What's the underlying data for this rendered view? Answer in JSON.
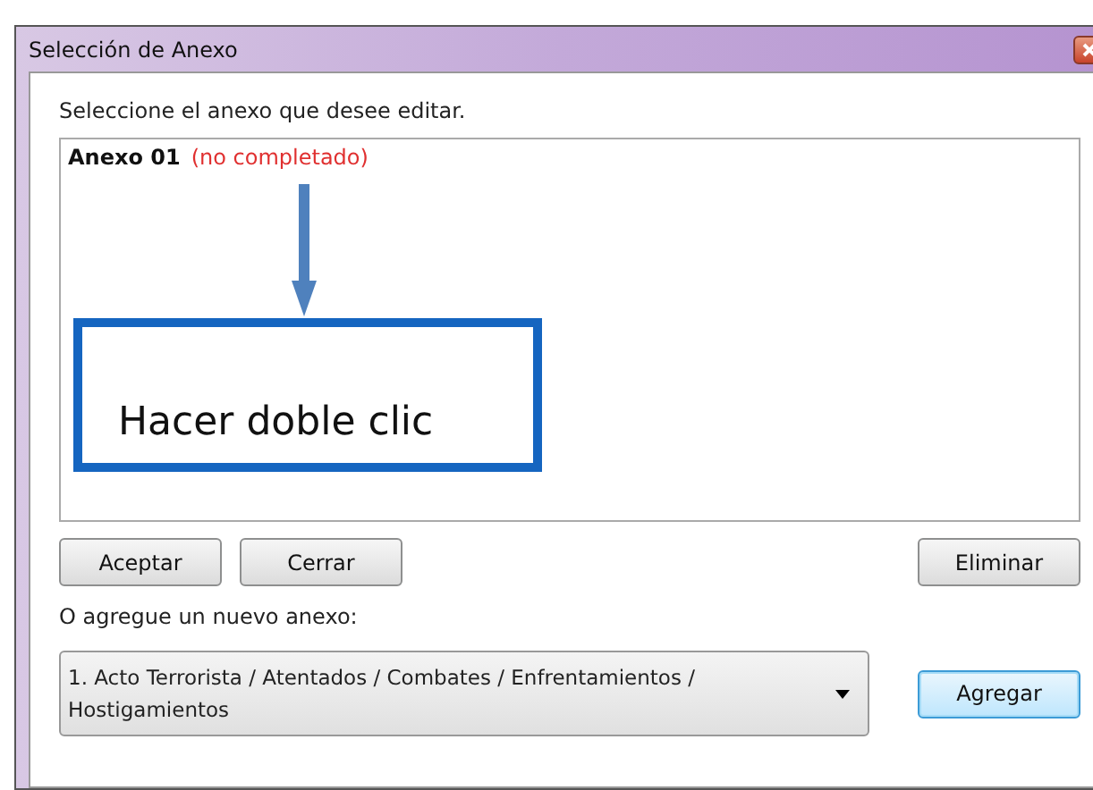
{
  "window": {
    "title": "Selección de Anexo"
  },
  "prompt": "Seleccione el anexo que desee editar.",
  "annexes": [
    {
      "name": "Anexo 01",
      "status": "(no completado)",
      "completed": false
    }
  ],
  "annotation": {
    "text": "Hacer doble clic"
  },
  "left_buttons": [
    "Aceptar",
    "Cerrar"
  ],
  "right_buttons": [
    "Eliminar"
  ],
  "add_label": "O agregue un nuevo anexo:",
  "annex_type": {
    "value": "1. Acto Terrorista / Atentados / Combates / Enfrentamientos / Hostigamientos"
  },
  "add_button": {
    "label": "Agregar",
    "focused": true
  }
}
